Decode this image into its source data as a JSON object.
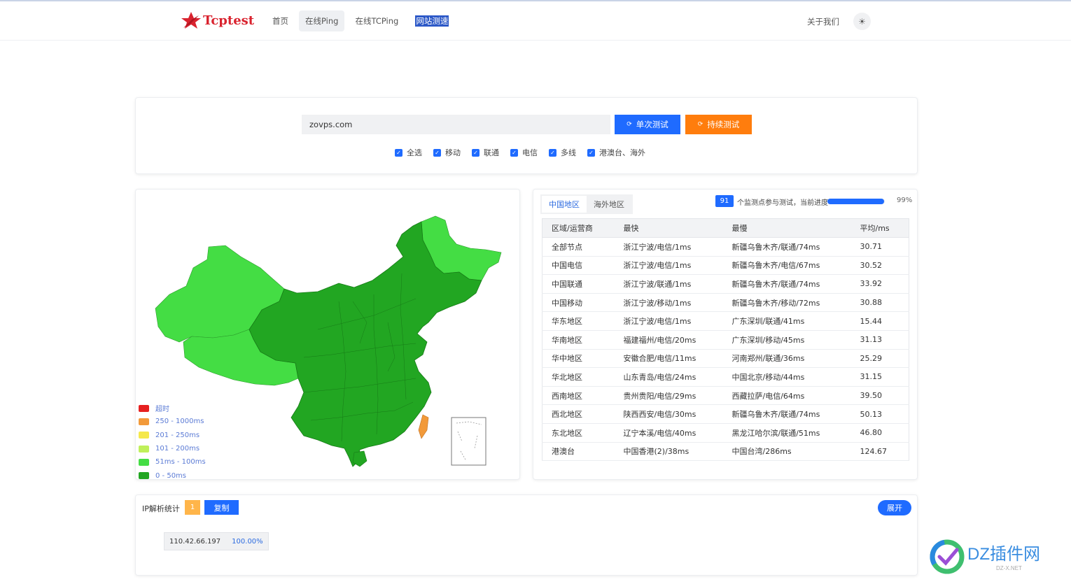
{
  "header": {
    "logo_text": "Tcptest",
    "nav": [
      "首页",
      "在线Ping",
      "在线TCPing",
      "网站测速"
    ],
    "about": "关于我们",
    "theme_icon": "sun-icon"
  },
  "search": {
    "value": "zovps.com",
    "single_label": "单次测试",
    "continuous_label": "持续测试",
    "checkboxes": [
      "全选",
      "移动",
      "联通",
      "电信",
      "多线",
      "港澳台、海外"
    ]
  },
  "legend": [
    {
      "label": "超时",
      "color": "#e62020"
    },
    {
      "label": "250 - 1000ms",
      "color": "#f29a3a"
    },
    {
      "label": "201 - 250ms",
      "color": "#f5e84a"
    },
    {
      "label": "101 - 200ms",
      "color": "#bff05a"
    },
    {
      "label": "51ms - 100ms",
      "color": "#44dd44"
    },
    {
      "label": "0 - 50ms",
      "color": "#22a622"
    }
  ],
  "results": {
    "tabs": [
      "中国地区",
      "海外地区"
    ],
    "count": "91",
    "count_text": "个监测点参与测试，当前进度",
    "progress": 99,
    "progress_text": "99%",
    "columns": [
      "区域/运营商",
      "最快",
      "最慢",
      "平均/ms"
    ],
    "rows": [
      [
        "全部节点",
        "浙江宁波/电信/1ms",
        "新疆乌鲁木齐/联通/74ms",
        "30.71"
      ],
      [
        "中国电信",
        "浙江宁波/电信/1ms",
        "新疆乌鲁木齐/电信/67ms",
        "30.52"
      ],
      [
        "中国联通",
        "浙江宁波/联通/1ms",
        "新疆乌鲁木齐/联通/74ms",
        "33.92"
      ],
      [
        "中国移动",
        "浙江宁波/移动/1ms",
        "新疆乌鲁木齐/移动/72ms",
        "30.88"
      ],
      [
        "华东地区",
        "浙江宁波/电信/1ms",
        "广东深圳/联通/41ms",
        "15.44"
      ],
      [
        "华南地区",
        "福建福州/电信/20ms",
        "广东深圳/移动/45ms",
        "31.13"
      ],
      [
        "华中地区",
        "安徽合肥/电信/11ms",
        "河南郑州/联通/36ms",
        "25.29"
      ],
      [
        "华北地区",
        "山东青岛/电信/24ms",
        "中国北京/移动/44ms",
        "31.15"
      ],
      [
        "西南地区",
        "贵州贵阳/电信/29ms",
        "西藏拉萨/电信/64ms",
        "39.50"
      ],
      [
        "西北地区",
        "陕西西安/电信/30ms",
        "新疆乌鲁木齐/联通/74ms",
        "50.13"
      ],
      [
        "东北地区",
        "辽宁本溪/电信/40ms",
        "黑龙江哈尔滨/联通/51ms",
        "46.80"
      ],
      [
        "港澳台",
        "中国香港(2)/38ms",
        "中国台湾/286ms",
        "124.67"
      ]
    ]
  },
  "ip": {
    "title": "IP解析统计",
    "count": "1",
    "copy_label": "复制",
    "expand_label": "展开",
    "entries": [
      {
        "ip": "110.42.66.197",
        "pct": "100.00%"
      }
    ]
  },
  "watermark": {
    "text": "DZ插件网",
    "sub": "DZ-X.NET"
  },
  "colors": {
    "primary": "#1f6bff",
    "orange": "#ff7d0d",
    "fast": "#22a622",
    "mid": "#44dd44",
    "slow": "#f29a3a"
  }
}
